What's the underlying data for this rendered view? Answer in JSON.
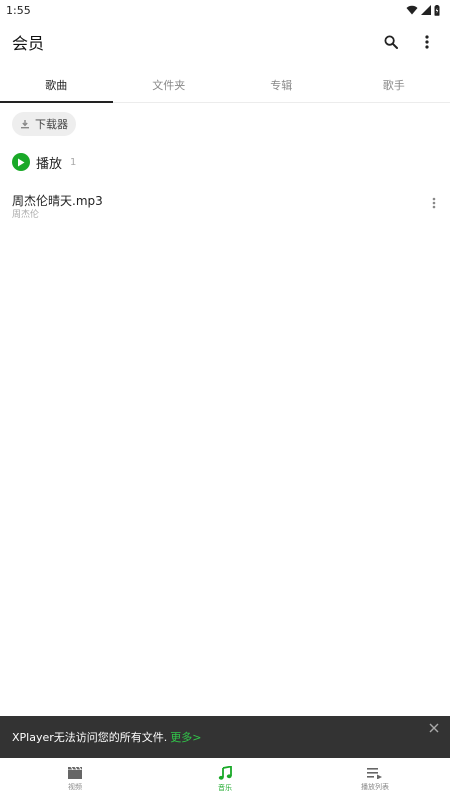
{
  "status_bar": {
    "time": "1:55"
  },
  "app_bar": {
    "title": "会员"
  },
  "tabs": [
    {
      "label": "歌曲",
      "active": true
    },
    {
      "label": "文件夹",
      "active": false
    },
    {
      "label": "专辑",
      "active": false
    },
    {
      "label": "歌手",
      "active": false
    }
  ],
  "filter_chip": {
    "label": "下载器"
  },
  "play_all": {
    "label": "播放",
    "count": "1"
  },
  "songs": [
    {
      "title": "周杰伦晴天.mp3",
      "artist": "周杰伦"
    }
  ],
  "snackbar": {
    "message": "XPlayer无法访问您的所有文件.",
    "action": "更多>"
  },
  "bottom_nav": [
    {
      "label": "视频",
      "icon": "clapperboard-icon",
      "active": false
    },
    {
      "label": "音乐",
      "icon": "music-note-icon",
      "active": true
    },
    {
      "label": "播放列表",
      "icon": "playlist-icon",
      "active": false
    }
  ],
  "colors": {
    "accent": "#1aa928",
    "snackbar_bg": "#333333",
    "snackbar_action": "#31c74a"
  }
}
